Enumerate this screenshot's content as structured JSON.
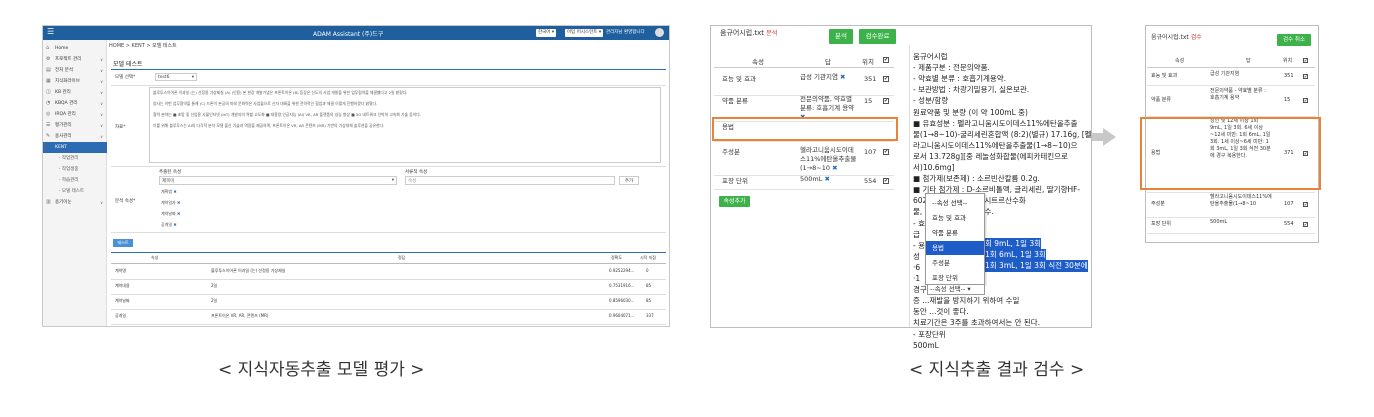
{
  "captions": {
    "left": "< 지식자동추출 모델 평가 >",
    "right": "< 지식추출 결과 검수 >"
  },
  "adam": {
    "app_title": "ADAM Assistant (주)드구",
    "lang_select": "한국어 ▾",
    "menu_select": "어텀 어시스턴트 ▾",
    "user_name": "관리자님 환영합니다",
    "breadcrumb": "HOME > KENT > 모델 테스트",
    "sidebar": [
      {
        "icon": "⌂",
        "label": "Home"
      },
      {
        "icon": "⚙",
        "label": "프로젝트 관리",
        "arrow": "∨"
      },
      {
        "icon": "▤",
        "label": "전처 분석",
        "arrow": "∨"
      },
      {
        "icon": "▦",
        "label": "지식화라이브",
        "arrow": "∨"
      },
      {
        "icon": "◫",
        "label": "KB 관리",
        "arrow": "∨"
      },
      {
        "icon": "◔",
        "label": "KBQA 관리",
        "arrow": "∨"
      },
      {
        "icon": "◎",
        "label": "IRQA 관리",
        "arrow": "∨"
      },
      {
        "icon": "☰",
        "label": "평가관리",
        "arrow": "∨"
      },
      {
        "icon": "✎",
        "label": "용사관리",
        "arrow": "∨"
      },
      {
        "icon": "▸",
        "label": "KENT",
        "arrow": "∧"
      },
      {
        "label": "· 작업관리"
      },
      {
        "label": "· 작업생중"
      },
      {
        "label": "· 학습관리"
      },
      {
        "label": "· 모델 테스트"
      },
      {
        "icon": "▥",
        "label": "용기이눈",
        "arrow": "∨"
      }
    ],
    "section_title": "모델 테스트",
    "model_label": "모델 선택*",
    "model_value": "test6",
    "sentence_label": "자료*",
    "paragraphs": [
      "블루투스이어폰 이과일 (는) 선정용 가상제실 (A) (인용) 본 현장 개발기념은 프론트이온 (B) 등장은 신도의 사업 개발을 위한 업무협약을 체결했다고 2일 밝혔다.",
      "양사는 이번 업무협약을 통해 (C) 드론이 본공의 미래 문화력은 사업물으로 신자 대륙을 위한 전략적인 협업과 체결 이렇게 진행하겠다 밝혔다.",
      "협력 분야는 ■ 초망 및 산업용 사물인터넷 (IoT) 개발자의 역할 고도화 ■ 대용량 인공지능 (AI) VR, AR 플랫폼의 성능 향상 ■ 5G 네트워크 선박의 고속화 기술 등이다.",
      "이를 위해 블루투스는 AI의 다각적 분석 모델 출신 기술과 역량을 제공하며, 프론트이온 VR, AR 콘텐츠 (MR) 기반의 가상대체 솔루션을 공유한다."
    ],
    "attr_label": "분석 속성*",
    "extract_label": "추출된 속성",
    "relation_label": "서류적 속성",
    "attr_select": "제목이",
    "relation_input": "속성",
    "add_button": "추가",
    "attr_tokens": [
      "계획법",
      "계약일자",
      "계약날짜",
      "공개일"
    ],
    "test_button": "테스트",
    "result_headers": [
      "속성",
      "정답",
      "정확도",
      "시작 지점"
    ],
    "result_rows": [
      {
        "attr": "계약명",
        "answer": "블루투스이어폰 이과일 (는) 선정용 가상제실",
        "acc": "0.9252294...",
        "pos": "0"
      },
      {
        "attr": "계약내용",
        "answer": "2일",
        "acc": "0.7531916...",
        "pos": "85"
      },
      {
        "attr": "계약날짜",
        "answer": "2일",
        "acc": "0.8596030...",
        "pos": "85"
      },
      {
        "attr": "공개일",
        "answer": "프론트이온 VR, AR, 콘텐츠 (MR)",
        "acc": "0.9604071...",
        "pos": "337"
      }
    ]
  },
  "review": {
    "file_name": "움규어시럽.txt",
    "status": "분석",
    "analyze_button": "분석",
    "review_done_button": "검수완료",
    "headers": {
      "attr": "속성",
      "answer": "답",
      "pos": "위치",
      "check": "✔"
    },
    "rows": [
      {
        "attr": "효능 및 효과",
        "answer": "급성 기관지염",
        "x": "✖",
        "pos": "351",
        "check": "✔"
      },
      {
        "attr": "약품 분류",
        "answer": "전문의약품, 약효별 분류: 호흡기계 용약",
        "x": "✖",
        "pos": "15",
        "check": "✔"
      },
      {
        "attr": "용법",
        "answer": "",
        "x": "",
        "pos": "",
        "check": ""
      },
      {
        "attr": "주성분",
        "answer": "헬라고니움시도이데스11%에탄올추출물(1→8~10",
        "x": "✖",
        "pos": "107",
        "check": "✔"
      },
      {
        "attr": "포장 단위",
        "answer": "500mL",
        "x": "✖",
        "pos": "554",
        "check": "✔"
      }
    ],
    "add_attr_button": "속성추가",
    "doc_lines": [
      "움규어시럽",
      "- 제품구분 : 전문의약품.",
      "- 약효별 분류 : 호흡기계용약.",
      "- 보관방법 : 차광기밀용기, 실온보관.",
      "- 성분/함량",
      "  원료약품 및 분량 (이 약 100mL 중)",
      "  ■ 유효성분 : 펠라고니움시도이데스11%에탄올추출",
      "물(1→8~10)-굴리세린혼합액 (8:2)(별규) 17.16g, [펠",
      "라고니움시도이데스11%에탄올추출물(1→8~10)으",
      "로서 13.728g][중 레놀성화합물(에피카테킨으로",
      "서)10.6mg]",
      "  ■ 첨가제(보존제) : 소르빈산칼륨 0.2g.",
      "  ■ 기타 첨가제 : D-소르비톨액, 글리세린, 딸기향HF-",
      "  602(...)배지, 나트륨, 시트르산수화",
      "물, 비트에산칼륨, 정제수.",
      "- 효",
      "  급",
      "- 용",
      "  성",
      "  ·6",
      "  ·1",
      "  경구",
      "  증 ...재발을 방지하기 위하여 수일",
      "  동안 ...것이 좋다.",
      "  치료기간은 3주를 초과하여서는 안 된다.",
      "- 포장단위",
      "  500mL"
    ],
    "hl_lines": [
      "회 9mL, 1일 3회",
      "1회 6mL, 1일 3회",
      "1회 3mL, 1일 3회 식전 30분에"
    ],
    "dropdown": [
      {
        "label": "--속성 선택--"
      },
      {
        "label": "효능 및 효과"
      },
      {
        "label": "약품 분류"
      },
      {
        "label": "용법",
        "selected": true
      },
      {
        "label": "주성분"
      },
      {
        "label": "포장 단위"
      }
    ],
    "dropdown_collapsed": "--속성 선택-- ▾"
  },
  "review_done": {
    "file_name": "움규어시럽.txt",
    "status": "검수",
    "cancel_button": "검수 취소",
    "headers": {
      "attr": "속성",
      "answer": "답",
      "pos": "위치",
      "check": "✔"
    },
    "rows": [
      {
        "attr": "효능 및 효과",
        "answer": "급성 기관지염",
        "pos": "351",
        "check": "✔"
      },
      {
        "attr": "약품 분류",
        "answer": "전문의약품 - 약효별 분류 : 호흡기계 용약",
        "pos": "15",
        "check": "✔"
      },
      {
        "attr": "용법",
        "answer": "성인 및 12세 이상 1회 9mL, 1일 3회. 6세 이상~12세 미만: 1회 6mL, 1일 3회. 1세 이상~6세 미만: 1회 3mL, 1일 3회 식전 30분에 경구 복용한다.",
        "pos": "371",
        "check": "✔"
      },
      {
        "attr": "주성분",
        "answer": "헬라고니움시도이데스11%에탄올추출물(1→8~10",
        "pos": "107",
        "check": "✔"
      },
      {
        "attr": "포장 단위",
        "answer": "500mL",
        "pos": "554",
        "check": "✔"
      }
    ]
  },
  "colors": {
    "accent": "#2d6cb3",
    "green": "#3db14a",
    "orange": "#e8843a",
    "highlight": "#1e5cc8"
  }
}
